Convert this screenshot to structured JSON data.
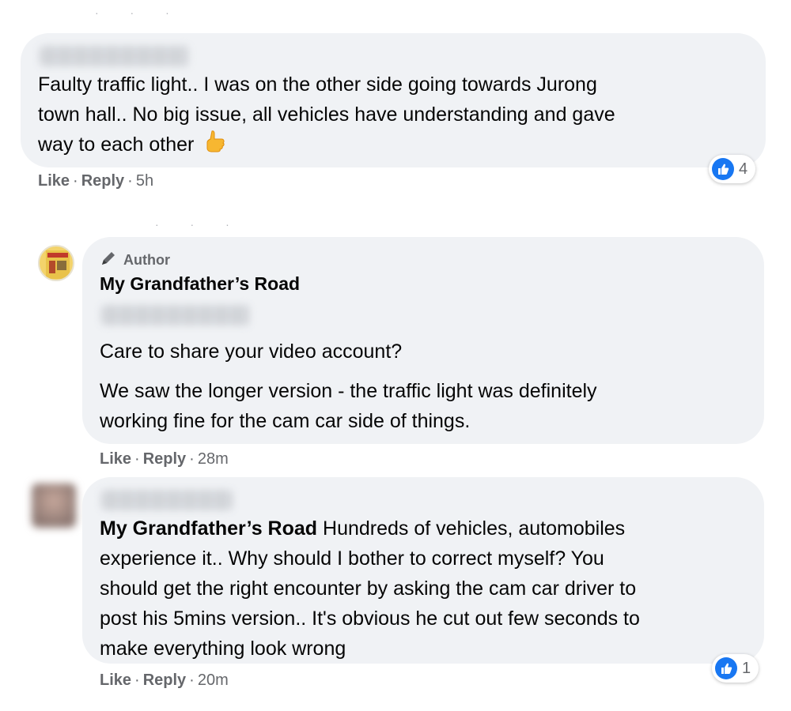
{
  "comments": [
    {
      "text": "Faulty traffic light.. I was on the other side going towards Jurong town hall.. No big issue, all vehicles have understanding and gave way to each other",
      "text_lines": [
        "Faulty traffic light.. I was on the other side going towards Jurong",
        "town hall.. No big issue, all vehicles have understanding and gave",
        "way to each other"
      ],
      "emoji": "thumbs-up-emoji",
      "actions": {
        "like": "Like",
        "reply": "Reply",
        "time": "5h"
      },
      "reactions": {
        "icon": "like-icon",
        "count": "4"
      }
    },
    {
      "author_badge": "Author",
      "author_badge_icon": "pencil-icon",
      "author_name": "My Grandfather’s Road",
      "text_1": "Care to share your video account?",
      "text_2_lines": [
        "We saw the longer version - the traffic light was definitely",
        "working fine for the cam car side of things."
      ],
      "actions": {
        "like": "Like",
        "reply": "Reply",
        "time": "28m"
      }
    },
    {
      "mention": "My Grandfather’s Road",
      "text_lines": [
        " Hundreds of vehicles, automobiles",
        "experience it.. Why should I bother to correct myself? You",
        "should get the right encounter by asking the cam car driver to",
        "post his 5mins version.. It's obvious he cut out few seconds to",
        "make everything look wrong"
      ],
      "actions": {
        "like": "Like",
        "reply": "Reply",
        "time": "20m"
      },
      "reactions": {
        "icon": "like-icon",
        "count": "1"
      }
    }
  ],
  "separator": "·",
  "colors": {
    "bubble": "#f0f2f5",
    "like_blue": "#1877f2",
    "meta_gray": "#65676b"
  }
}
